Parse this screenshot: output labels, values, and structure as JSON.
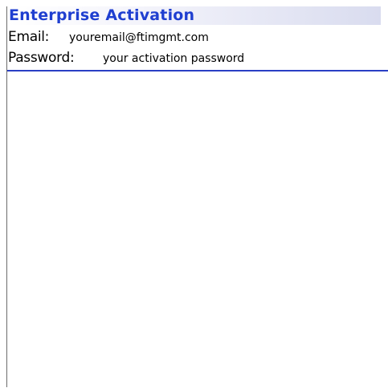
{
  "screen": {
    "title": "Enterprise Activation",
    "fields": {
      "email": {
        "label": "Email:",
        "value": "youremail@ftimgmt.com"
      },
      "password": {
        "label": "Password:",
        "value": "your activation password"
      }
    }
  },
  "colors": {
    "title_text": "#1f3fd0",
    "separator": "#2a3fc4"
  }
}
